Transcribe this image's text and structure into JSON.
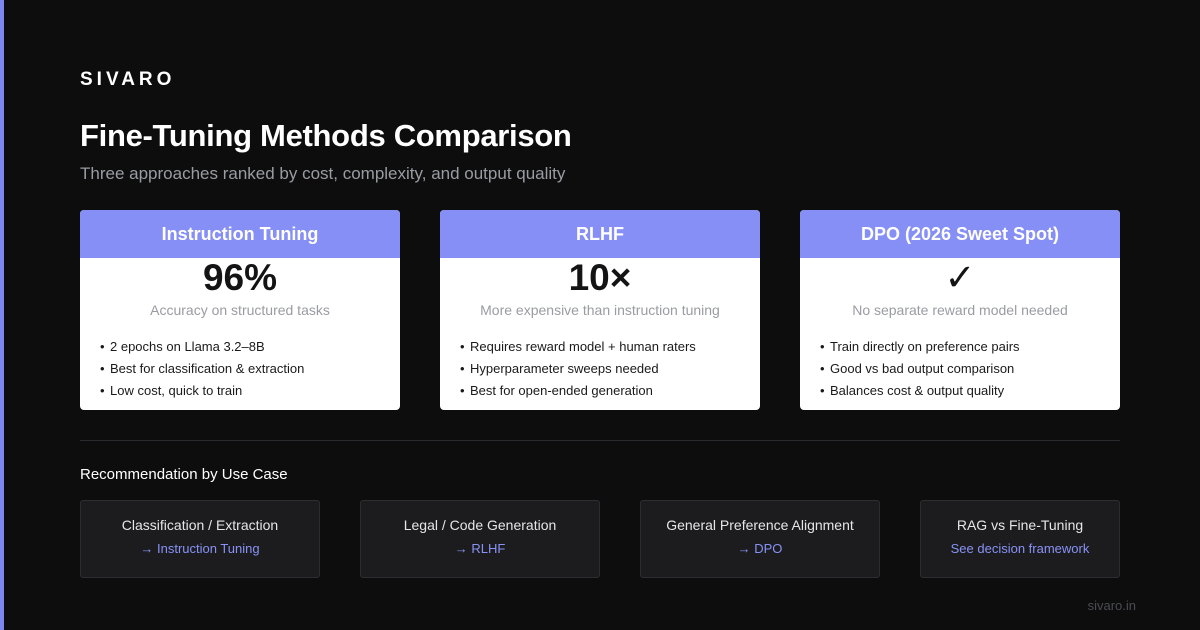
{
  "brand": "SIVARO",
  "title": "Fine-Tuning Methods Comparison",
  "subtitle": "Three approaches ranked by cost, complexity, and output quality",
  "accent_color": "#7b86ee",
  "card_header_color": "#868ff5",
  "cards": [
    {
      "header": "Instruction Tuning",
      "stat": "96%",
      "stat_label": "Accuracy on structured tasks",
      "bullets": [
        "2 epochs on Llama 3.2–8B",
        "Best for classification & extraction",
        "Low cost, quick to train"
      ]
    },
    {
      "header": "RLHF",
      "stat": "10×",
      "stat_label": "More expensive than instruction tuning",
      "bullets": [
        "Requires reward model + human raters",
        "Hyperparameter sweeps needed",
        "Best for open-ended generation"
      ]
    },
    {
      "header": "DPO (2026 Sweet Spot)",
      "stat": "✓",
      "stat_label": "No separate reward model needed",
      "bullets": [
        "Train directly on preference pairs",
        "Good vs bad output comparison",
        "Balances cost & output quality"
      ]
    }
  ],
  "recommendation": {
    "heading": "Recommendation by Use Case",
    "items": [
      {
        "label": "Classification / Extraction",
        "value": "→ Instruction Tuning"
      },
      {
        "label": "Legal / Code Generation",
        "value": "→ RLHF"
      },
      {
        "label": "General Preference Alignment",
        "value": "→ DPO"
      },
      {
        "label": "RAG vs Fine-Tuning",
        "value": "See decision framework"
      }
    ]
  },
  "footer": "sivaro.in"
}
